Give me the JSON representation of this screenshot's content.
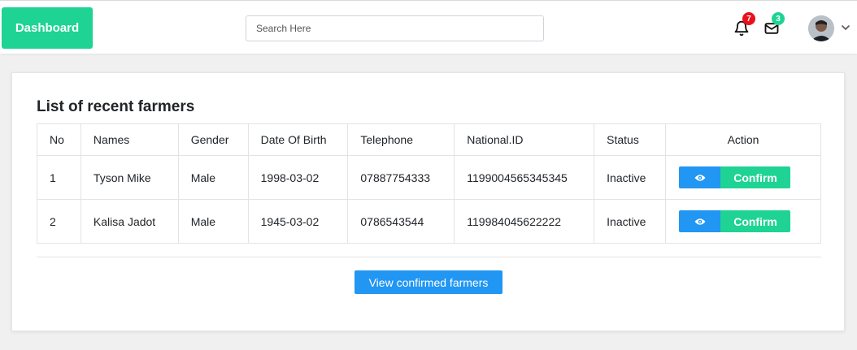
{
  "header": {
    "brand_label": "Dashboard",
    "search_placeholder": "Search Here",
    "notifications_count": "7",
    "messages_count": "3",
    "colors": {
      "brand": "#1ed394",
      "notif_badge": "#e8111c",
      "msg_badge": "#1ed394"
    }
  },
  "main": {
    "title": "List of recent farmers",
    "columns": [
      "No",
      "Names",
      "Gender",
      "Date Of Birth",
      "Telephone",
      "National.ID",
      "Status",
      "Action"
    ],
    "rows": [
      {
        "no": "1",
        "name": "Tyson Mike",
        "gender": "Male",
        "dob": "1998-03-02",
        "telephone": "07887754333",
        "national_id": "1199004565345345",
        "status": "Inactive",
        "confirm_label": "Confirm"
      },
      {
        "no": "2",
        "name": "Kalisa Jadot",
        "gender": "Male",
        "dob": "1945-03-02",
        "telephone": "0786543544",
        "national_id": "119984045622222",
        "status": "Inactive",
        "confirm_label": "Confirm"
      }
    ],
    "view_confirmed_label": "View confirmed farmers",
    "colors": {
      "primary": "#2196f3",
      "success": "#1ed394"
    }
  }
}
